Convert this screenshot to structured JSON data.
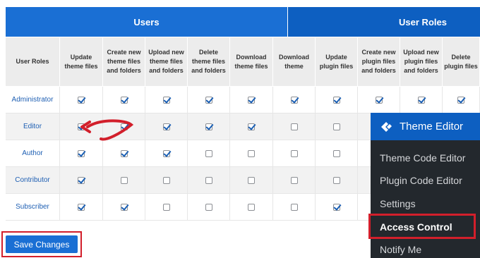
{
  "tabs": {
    "users": "Users",
    "roles": "User Roles"
  },
  "columns": [
    "User Roles",
    "Update theme files",
    "Create new theme files and folders",
    "Upload new theme files and folders",
    "Delete theme files and folders",
    "Download theme files",
    "Download theme",
    "Update plugin files",
    "Create new plugin files and folders",
    "Upload new plugin files and folders",
    "Delete plugin files"
  ],
  "rows": [
    {
      "role": "Administrator",
      "checks": [
        true,
        true,
        true,
        true,
        true,
        true,
        true,
        true,
        true,
        true
      ]
    },
    {
      "role": "Editor",
      "checks": [
        true,
        true,
        true,
        true,
        true,
        false,
        false,
        false,
        false,
        false
      ]
    },
    {
      "role": "Author",
      "checks": [
        true,
        true,
        true,
        false,
        false,
        false,
        false,
        false,
        false,
        false
      ]
    },
    {
      "role": "Contributor",
      "checks": [
        true,
        false,
        false,
        false,
        false,
        false,
        false,
        false,
        false,
        false
      ]
    },
    {
      "role": "Subscriber",
      "checks": [
        true,
        true,
        false,
        false,
        false,
        false,
        true,
        false,
        false,
        false
      ]
    }
  ],
  "save_button": "Save Changes",
  "menu": {
    "title": "Theme Editor",
    "items": [
      "Theme Code Editor",
      "Plugin Code Editor",
      "Settings",
      "Access Control",
      "Notify Me"
    ]
  },
  "colors": {
    "accent": "#1a6fd4",
    "highlight": "#d21f2b"
  }
}
